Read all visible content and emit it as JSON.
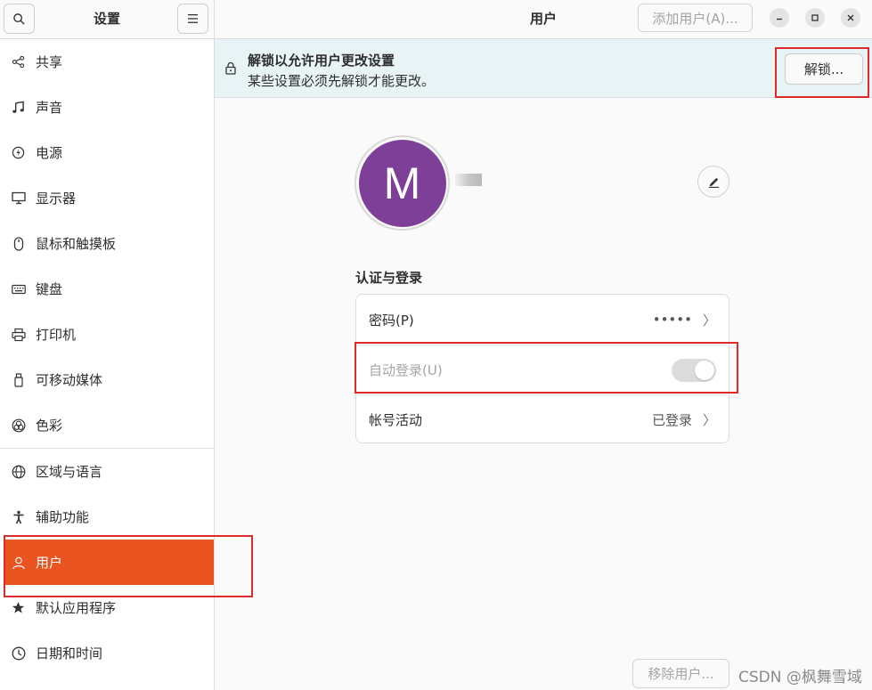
{
  "sidebar": {
    "title": "设置",
    "search_icon": "search-icon",
    "menu_icon": "hamburger-menu-icon",
    "items": [
      {
        "label": "共享",
        "icon": "share-icon"
      },
      {
        "label": "声音",
        "icon": "music-note-icon"
      },
      {
        "label": "电源",
        "icon": "power-icon"
      },
      {
        "label": "显示器",
        "icon": "display-icon"
      },
      {
        "label": "鼠标和触摸板",
        "icon": "mouse-icon"
      },
      {
        "label": "键盘",
        "icon": "keyboard-icon"
      },
      {
        "label": "打印机",
        "icon": "printer-icon"
      },
      {
        "label": "可移动媒体",
        "icon": "usb-drive-icon"
      },
      {
        "label": "色彩",
        "icon": "color-icon"
      },
      {
        "label": "区域与语言",
        "icon": "globe-icon"
      },
      {
        "label": "辅助功能",
        "icon": "accessibility-icon"
      },
      {
        "label": "用户",
        "icon": "users-icon",
        "active": true
      },
      {
        "label": "默认应用程序",
        "icon": "star-icon"
      },
      {
        "label": "日期和时间",
        "icon": "clock-icon"
      }
    ]
  },
  "header": {
    "title": "用户",
    "add_user_label": "添加用户(A)..."
  },
  "banner": {
    "title": "解锁以允许用户更改设置",
    "subtitle": "某些设置必须先解锁才能更改。",
    "unlock_label": "解锁..."
  },
  "profile": {
    "avatar_letter": "M",
    "avatar_color": "#7e3f98"
  },
  "auth": {
    "section_title": "认证与登录",
    "password_label": "密码(P)",
    "password_value": "•••••",
    "autologin_label": "自动登录(U)",
    "autologin_on": false,
    "account_activity_label": "帐号活动",
    "account_activity_value": "已登录"
  },
  "footer": {
    "remove_user_label": "移除用户...",
    "watermark": "CSDN @枫舞雪域"
  },
  "colors": {
    "accent": "#e95420",
    "highlight_box": "#e02a2a",
    "banner_bg": "#e8f3f6"
  }
}
